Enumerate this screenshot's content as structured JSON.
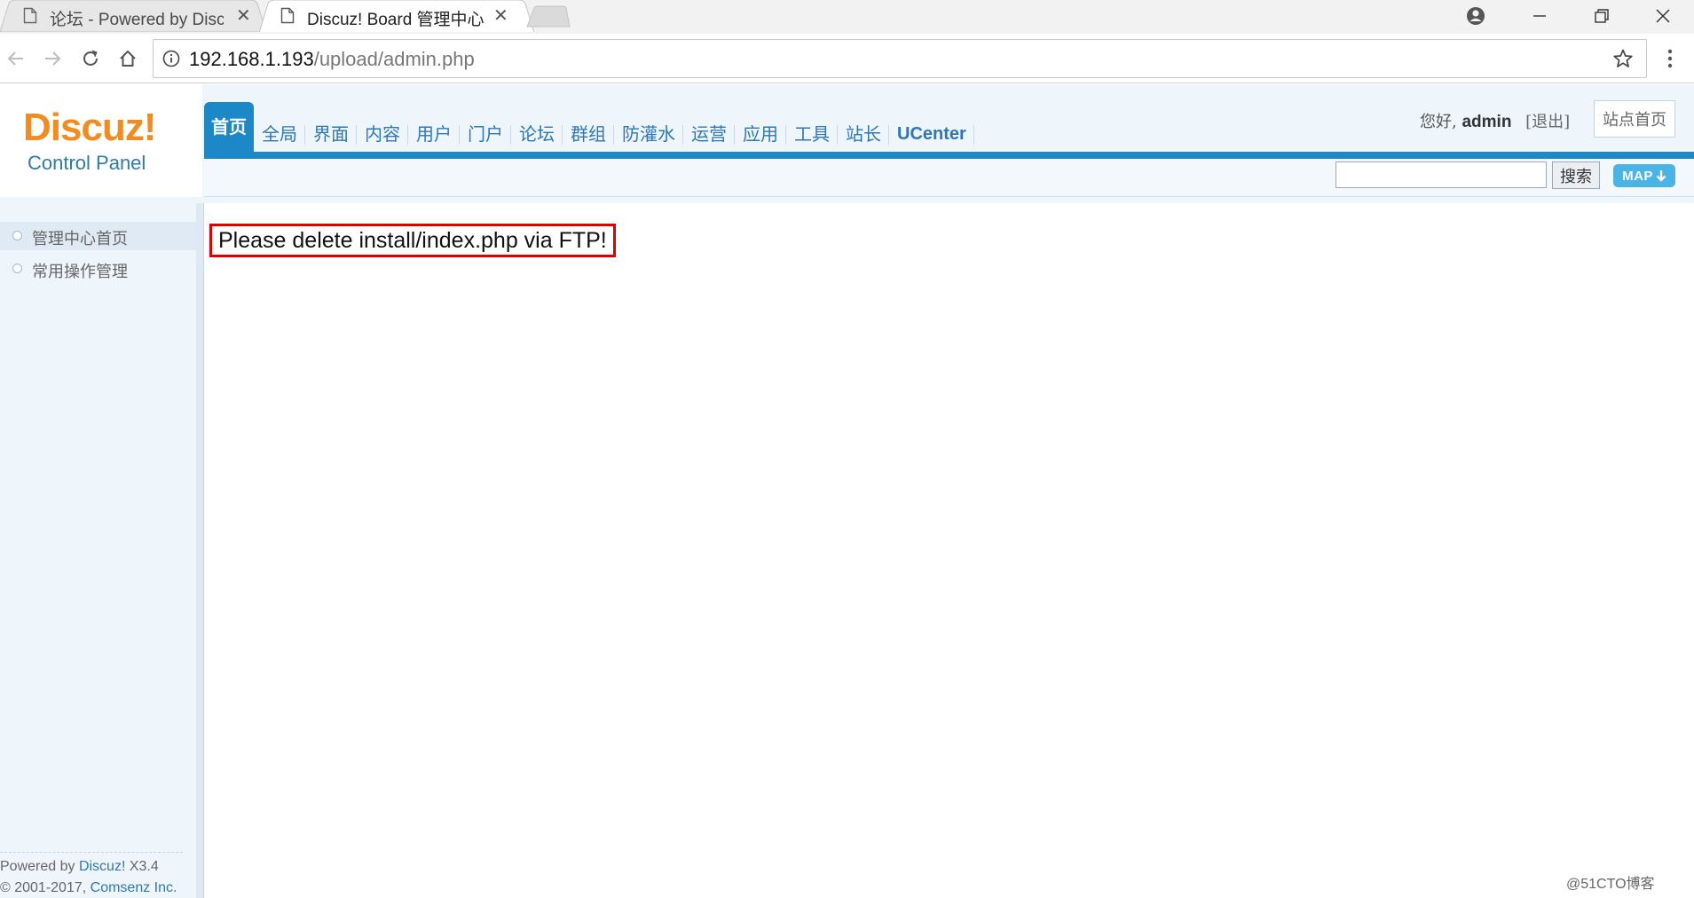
{
  "browser": {
    "tabs": [
      {
        "title": "论坛 - Powered by Discuz!"
      },
      {
        "title": "Discuz! Board 管理中心"
      }
    ],
    "address": {
      "host": "192.168.1.193",
      "path": "/upload/admin.php"
    },
    "icons": {
      "back": "arrow-left-icon",
      "forward": "arrow-right-icon",
      "reload": "reload-icon",
      "home": "home-icon",
      "info": "info-circle-icon",
      "bookmark": "star-icon",
      "menu": "kebab-menu-icon",
      "profile": "account-circle-icon",
      "minimize": "minimize-icon",
      "restore": "restore-window-icon",
      "close": "close-icon"
    }
  },
  "logo": {
    "brand": "Discuz!",
    "subtitle": "Control Panel"
  },
  "topnav": {
    "items": [
      "首页",
      "全局",
      "界面",
      "内容",
      "用户",
      "门户",
      "论坛",
      "群组",
      "防灌水",
      "运营",
      "应用",
      "工具",
      "站长",
      "UCenter"
    ],
    "active_index": 0
  },
  "user": {
    "greeting": "您好,",
    "name": "admin",
    "logout": "[退出]",
    "site_home": "站点首页"
  },
  "search": {
    "value": "",
    "button": "搜索",
    "map_button": "MAP"
  },
  "sidebar": {
    "items": [
      {
        "label": "管理中心首页",
        "active": true
      },
      {
        "label": "常用操作管理",
        "active": false
      }
    ],
    "footer": {
      "line1_prefix": "Powered by ",
      "line1_link": "Discuz!",
      "line1_suffix": " X3.4",
      "line2_prefix": "© 2001-2017, ",
      "line2_link": "Comsenz Inc."
    }
  },
  "main": {
    "notice": "Please delete install/index.php via FTP!"
  },
  "watermark": "@51CTO博客",
  "colors": {
    "accent": "#1d88c8",
    "logo_orange": "#f28c1e",
    "notice_border": "#e00000",
    "link": "#2d77b9"
  }
}
